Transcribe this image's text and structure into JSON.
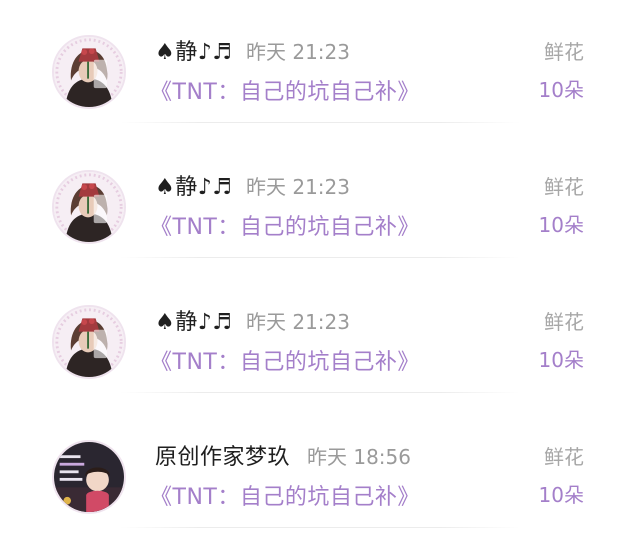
{
  "rows": [
    {
      "name": "♠静♪♬",
      "time": "昨天 21:23",
      "book": "《TNT：自己的坑自己补》",
      "gift": "鲜花",
      "count": "10朵"
    },
    {
      "name": "♠静♪♬",
      "time": "昨天 21:23",
      "book": "《TNT：自己的坑自己补》",
      "gift": "鲜花",
      "count": "10朵"
    },
    {
      "name": "♠静♪♬",
      "time": "昨天 21:23",
      "book": "《TNT：自己的坑自己补》",
      "gift": "鲜花",
      "count": "10朵"
    },
    {
      "name": "原创作家梦玖",
      "time": "昨天 18:56",
      "book": "《TNT：自己的坑自己补》",
      "gift": "鲜花",
      "count": "10朵"
    }
  ],
  "colors": {
    "accent": "#a47fca",
    "muted": "#9a9a9a",
    "text": "#1f1f1f"
  },
  "icons": {
    "avatar_1": "girl-with-flower-avatar",
    "avatar_2": "girl-with-flower-avatar",
    "avatar_3": "girl-with-flower-avatar",
    "avatar_4": "child-photo-avatar"
  }
}
